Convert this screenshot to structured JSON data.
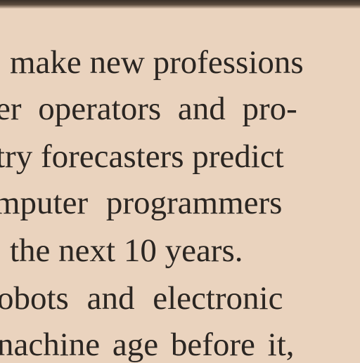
{
  "document": {
    "lines": [
      "make new professions",
      "er operators and pro-",
      "try forecasters predict",
      "mputer programmers",
      "the next 10 years.",
      "obots and electronic",
      "nachine age before it,"
    ]
  }
}
